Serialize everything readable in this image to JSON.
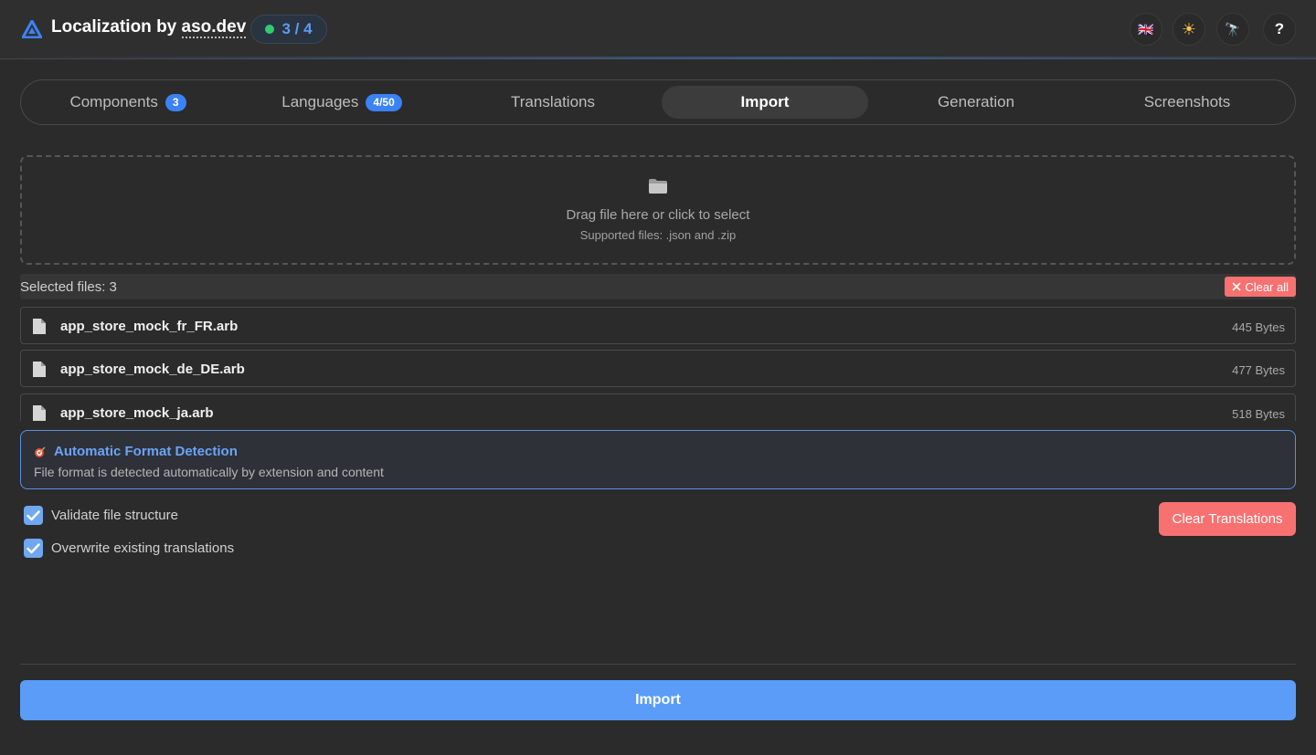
{
  "header": {
    "title_prefix": "Localization by ",
    "title_brand": "aso.dev",
    "counter": "3 / 4",
    "buttons": [
      {
        "icon": "uk-flag-icon",
        "glyph": "🇬🇧"
      },
      {
        "icon": "sun-icon",
        "glyph": "☀"
      },
      {
        "icon": "telescope-icon",
        "glyph": "🔭"
      },
      {
        "icon": "help-icon",
        "glyph": "?"
      }
    ]
  },
  "tabs": [
    {
      "label": "Components",
      "badge": "3"
    },
    {
      "label": "Languages",
      "badge": "4/50"
    },
    {
      "label": "Translations"
    },
    {
      "label": "Import",
      "active": true
    },
    {
      "label": "Generation"
    },
    {
      "label": "Screenshots"
    }
  ],
  "dropzone": {
    "main": "Drag file here or click to select",
    "sub": "Supported files: .json and .zip"
  },
  "files": {
    "count_label": "Selected files: 3",
    "clear_all": "Clear all",
    "items": [
      {
        "name": "app_store_mock_fr_FR.arb",
        "size": "445 Bytes"
      },
      {
        "name": "app_store_mock_de_DE.arb",
        "size": "477 Bytes"
      },
      {
        "name": "app_store_mock_ja.arb",
        "size": "518 Bytes"
      }
    ]
  },
  "format": {
    "title": "Automatic Format Detection",
    "description": "File format is detected automatically by extension and content"
  },
  "options": {
    "validate": "Validate file structure",
    "overwrite": "Overwrite existing translations"
  },
  "actions": {
    "clear_translations": "Clear Translations",
    "import": "Import"
  },
  "colors": {
    "accent": "#5b9cf8",
    "danger": "#f87171",
    "background": "#2b2b2b"
  }
}
